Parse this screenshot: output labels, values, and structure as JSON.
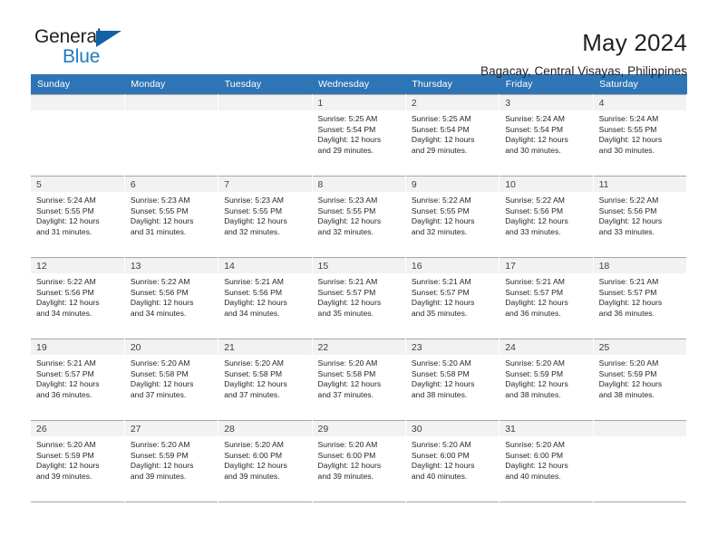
{
  "brand": {
    "name_top": "General",
    "name_bottom": "Blue",
    "triangle_color": "#1160a8",
    "blue_color": "#1f7bc1"
  },
  "header": {
    "title": "May 2024",
    "subtitle": "Bagacay, Central Visayas, Philippines"
  },
  "theme": {
    "header_row_bg": "#2e75b6",
    "daynum_bg": "#f2f2f2",
    "grid_line": "#a6a6a6"
  },
  "weekdays": [
    "Sunday",
    "Monday",
    "Tuesday",
    "Wednesday",
    "Thursday",
    "Friday",
    "Saturday"
  ],
  "weeks": [
    [
      {
        "day": "",
        "empty": true
      },
      {
        "day": "",
        "empty": true
      },
      {
        "day": "",
        "empty": true
      },
      {
        "day": "1",
        "sunrise": "Sunrise: 5:25 AM",
        "sunset": "Sunset: 5:54 PM",
        "daylight1": "Daylight: 12 hours",
        "daylight2": "and 29 minutes."
      },
      {
        "day": "2",
        "sunrise": "Sunrise: 5:25 AM",
        "sunset": "Sunset: 5:54 PM",
        "daylight1": "Daylight: 12 hours",
        "daylight2": "and 29 minutes."
      },
      {
        "day": "3",
        "sunrise": "Sunrise: 5:24 AM",
        "sunset": "Sunset: 5:54 PM",
        "daylight1": "Daylight: 12 hours",
        "daylight2": "and 30 minutes."
      },
      {
        "day": "4",
        "sunrise": "Sunrise: 5:24 AM",
        "sunset": "Sunset: 5:55 PM",
        "daylight1": "Daylight: 12 hours",
        "daylight2": "and 30 minutes."
      }
    ],
    [
      {
        "day": "5",
        "sunrise": "Sunrise: 5:24 AM",
        "sunset": "Sunset: 5:55 PM",
        "daylight1": "Daylight: 12 hours",
        "daylight2": "and 31 minutes."
      },
      {
        "day": "6",
        "sunrise": "Sunrise: 5:23 AM",
        "sunset": "Sunset: 5:55 PM",
        "daylight1": "Daylight: 12 hours",
        "daylight2": "and 31 minutes."
      },
      {
        "day": "7",
        "sunrise": "Sunrise: 5:23 AM",
        "sunset": "Sunset: 5:55 PM",
        "daylight1": "Daylight: 12 hours",
        "daylight2": "and 32 minutes."
      },
      {
        "day": "8",
        "sunrise": "Sunrise: 5:23 AM",
        "sunset": "Sunset: 5:55 PM",
        "daylight1": "Daylight: 12 hours",
        "daylight2": "and 32 minutes."
      },
      {
        "day": "9",
        "sunrise": "Sunrise: 5:22 AM",
        "sunset": "Sunset: 5:55 PM",
        "daylight1": "Daylight: 12 hours",
        "daylight2": "and 32 minutes."
      },
      {
        "day": "10",
        "sunrise": "Sunrise: 5:22 AM",
        "sunset": "Sunset: 5:56 PM",
        "daylight1": "Daylight: 12 hours",
        "daylight2": "and 33 minutes."
      },
      {
        "day": "11",
        "sunrise": "Sunrise: 5:22 AM",
        "sunset": "Sunset: 5:56 PM",
        "daylight1": "Daylight: 12 hours",
        "daylight2": "and 33 minutes."
      }
    ],
    [
      {
        "day": "12",
        "sunrise": "Sunrise: 5:22 AM",
        "sunset": "Sunset: 5:56 PM",
        "daylight1": "Daylight: 12 hours",
        "daylight2": "and 34 minutes."
      },
      {
        "day": "13",
        "sunrise": "Sunrise: 5:22 AM",
        "sunset": "Sunset: 5:56 PM",
        "daylight1": "Daylight: 12 hours",
        "daylight2": "and 34 minutes."
      },
      {
        "day": "14",
        "sunrise": "Sunrise: 5:21 AM",
        "sunset": "Sunset: 5:56 PM",
        "daylight1": "Daylight: 12 hours",
        "daylight2": "and 34 minutes."
      },
      {
        "day": "15",
        "sunrise": "Sunrise: 5:21 AM",
        "sunset": "Sunset: 5:57 PM",
        "daylight1": "Daylight: 12 hours",
        "daylight2": "and 35 minutes."
      },
      {
        "day": "16",
        "sunrise": "Sunrise: 5:21 AM",
        "sunset": "Sunset: 5:57 PM",
        "daylight1": "Daylight: 12 hours",
        "daylight2": "and 35 minutes."
      },
      {
        "day": "17",
        "sunrise": "Sunrise: 5:21 AM",
        "sunset": "Sunset: 5:57 PM",
        "daylight1": "Daylight: 12 hours",
        "daylight2": "and 36 minutes."
      },
      {
        "day": "18",
        "sunrise": "Sunrise: 5:21 AM",
        "sunset": "Sunset: 5:57 PM",
        "daylight1": "Daylight: 12 hours",
        "daylight2": "and 36 minutes."
      }
    ],
    [
      {
        "day": "19",
        "sunrise": "Sunrise: 5:21 AM",
        "sunset": "Sunset: 5:57 PM",
        "daylight1": "Daylight: 12 hours",
        "daylight2": "and 36 minutes."
      },
      {
        "day": "20",
        "sunrise": "Sunrise: 5:20 AM",
        "sunset": "Sunset: 5:58 PM",
        "daylight1": "Daylight: 12 hours",
        "daylight2": "and 37 minutes."
      },
      {
        "day": "21",
        "sunrise": "Sunrise: 5:20 AM",
        "sunset": "Sunset: 5:58 PM",
        "daylight1": "Daylight: 12 hours",
        "daylight2": "and 37 minutes."
      },
      {
        "day": "22",
        "sunrise": "Sunrise: 5:20 AM",
        "sunset": "Sunset: 5:58 PM",
        "daylight1": "Daylight: 12 hours",
        "daylight2": "and 37 minutes."
      },
      {
        "day": "23",
        "sunrise": "Sunrise: 5:20 AM",
        "sunset": "Sunset: 5:58 PM",
        "daylight1": "Daylight: 12 hours",
        "daylight2": "and 38 minutes."
      },
      {
        "day": "24",
        "sunrise": "Sunrise: 5:20 AM",
        "sunset": "Sunset: 5:59 PM",
        "daylight1": "Daylight: 12 hours",
        "daylight2": "and 38 minutes."
      },
      {
        "day": "25",
        "sunrise": "Sunrise: 5:20 AM",
        "sunset": "Sunset: 5:59 PM",
        "daylight1": "Daylight: 12 hours",
        "daylight2": "and 38 minutes."
      }
    ],
    [
      {
        "day": "26",
        "sunrise": "Sunrise: 5:20 AM",
        "sunset": "Sunset: 5:59 PM",
        "daylight1": "Daylight: 12 hours",
        "daylight2": "and 39 minutes."
      },
      {
        "day": "27",
        "sunrise": "Sunrise: 5:20 AM",
        "sunset": "Sunset: 5:59 PM",
        "daylight1": "Daylight: 12 hours",
        "daylight2": "and 39 minutes."
      },
      {
        "day": "28",
        "sunrise": "Sunrise: 5:20 AM",
        "sunset": "Sunset: 6:00 PM",
        "daylight1": "Daylight: 12 hours",
        "daylight2": "and 39 minutes."
      },
      {
        "day": "29",
        "sunrise": "Sunrise: 5:20 AM",
        "sunset": "Sunset: 6:00 PM",
        "daylight1": "Daylight: 12 hours",
        "daylight2": "and 39 minutes."
      },
      {
        "day": "30",
        "sunrise": "Sunrise: 5:20 AM",
        "sunset": "Sunset: 6:00 PM",
        "daylight1": "Daylight: 12 hours",
        "daylight2": "and 40 minutes."
      },
      {
        "day": "31",
        "sunrise": "Sunrise: 5:20 AM",
        "sunset": "Sunset: 6:00 PM",
        "daylight1": "Daylight: 12 hours",
        "daylight2": "and 40 minutes."
      },
      {
        "day": "",
        "empty": true
      }
    ]
  ]
}
